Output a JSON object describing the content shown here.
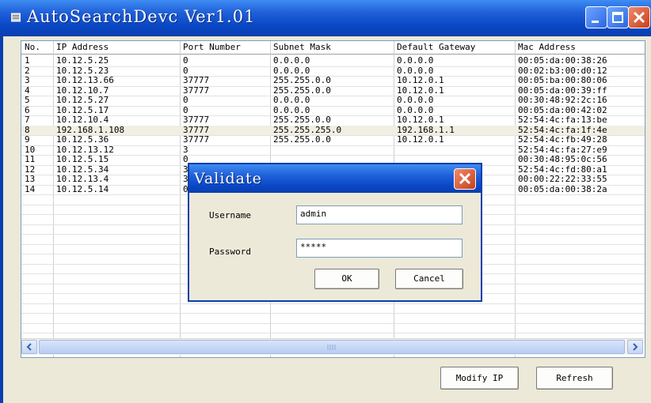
{
  "window": {
    "title": "AutoSearchDevc Ver1.01"
  },
  "table": {
    "columns": [
      "No.",
      "IP Address",
      "Port Number",
      "Subnet Mask",
      "Default Gateway",
      "Mac Address"
    ],
    "selected_row": 8,
    "rows": [
      [
        "1",
        "10.12.5.25",
        "0",
        "0.0.0.0",
        "0.0.0.0",
        "00:05:da:00:38:26"
      ],
      [
        "2",
        "10.12.5.23",
        "0",
        "0.0.0.0",
        "0.0.0.0",
        "00:02:b3:00:d0:12"
      ],
      [
        "3",
        "10.12.13.66",
        "37777",
        "255.255.0.0",
        "10.12.0.1",
        "00:05:ba:00:80:06"
      ],
      [
        "4",
        "10.12.10.7",
        "37777",
        "255.255.0.0",
        "10.12.0.1",
        "00:05:da:00:39:ff"
      ],
      [
        "5",
        "10.12.5.27",
        "0",
        "0.0.0.0",
        "0.0.0.0",
        "00:30:48:92:2c:16"
      ],
      [
        "6",
        "10.12.5.17",
        "0",
        "0.0.0.0",
        "0.0.0.0",
        "00:05:da:00:42:02"
      ],
      [
        "7",
        "10.12.10.4",
        "37777",
        "255.255.0.0",
        "10.12.0.1",
        "52:54:4c:fa:13:be"
      ],
      [
        "8",
        "192.168.1.108",
        "37777",
        "255.255.255.0",
        "192.168.1.1",
        "52:54:4c:fa:1f:4e"
      ],
      [
        "9",
        "10.12.5.36",
        "37777",
        "255.255.0.0",
        "10.12.0.1",
        "52:54:4c:fb:49:28"
      ],
      [
        "10",
        "10.12.13.12",
        "3",
        "",
        "",
        "52:54:4c:fa:27:e9"
      ],
      [
        "11",
        "10.12.5.15",
        "0",
        "",
        "",
        "00:30:48:95:0c:56"
      ],
      [
        "12",
        "10.12.5.34",
        "3",
        "",
        "",
        "52:54:4c:fd:80:a1"
      ],
      [
        "13",
        "10.12.13.4",
        "3",
        "",
        "",
        "00:00:22:22:33:55"
      ],
      [
        "14",
        "10.12.5.14",
        "0",
        "",
        "",
        "00:05:da:00:38:2a"
      ]
    ]
  },
  "buttons": {
    "modify_ip": "Modify IP",
    "refresh": "Refresh"
  },
  "dialog": {
    "title": "Validate",
    "username_label": "Username",
    "username_value": "admin",
    "password_label": "Password",
    "password_value": "*****",
    "ok_label": "OK",
    "cancel_label": "Cancel"
  },
  "colors": {
    "titlebar_blue": "#0b48c6",
    "close_red": "#c8401c",
    "selected_row": "#f1efe2"
  },
  "icons": [
    "app-icon",
    "minimize-icon",
    "maximize-icon",
    "close-icon",
    "scroll-left-arrow-icon",
    "scroll-right-arrow-icon"
  ]
}
